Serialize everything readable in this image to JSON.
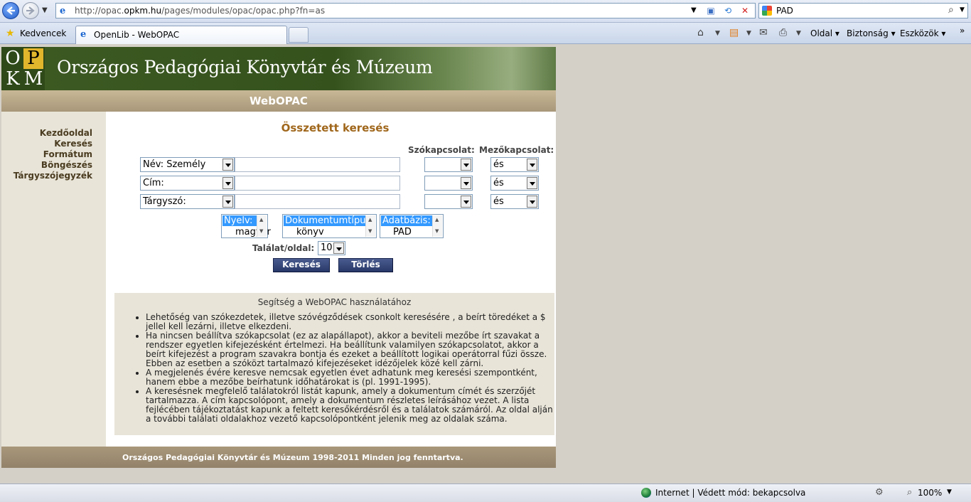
{
  "browser": {
    "url_prefix": "http://opac.",
    "url_host": "opkm.hu",
    "url_path": "/pages/modules/opac/opac.php?fn=as",
    "search_text": "PAD",
    "favorites_label": "Kedvencek",
    "tab_title": "OpenLib - WebOPAC",
    "menu": {
      "page": "Oldal",
      "security": "Biztonság",
      "tools": "Eszközök"
    },
    "status": {
      "zone": "Internet | Védett mód: bekapcsolva",
      "zoom": "100%"
    }
  },
  "site": {
    "logo_letters": [
      "O",
      "P",
      "K",
      "M"
    ],
    "title": "Országos Pedagógiai Könyvtár és Múzeum",
    "subtitle": "WebOPAC",
    "footer": "Országos Pedagógiai Könyvtár és Múzeum 1998-2011 Minden jog fenntartva."
  },
  "sidebar": {
    "items": [
      {
        "label": "Kezdőoldal"
      },
      {
        "label": "Keresés"
      },
      {
        "label": "Formátum"
      },
      {
        "label": "Böngészés"
      },
      {
        "label": "Tárgyszójegyzék"
      }
    ]
  },
  "form": {
    "title": "Összetett keresés",
    "word_relation_header": "Szókapcsolat:",
    "field_relation_header": "Mezőkapcsolat:",
    "rows": [
      {
        "field": "Név: Személy",
        "value": "",
        "word_relation": "",
        "field_relation": "és"
      },
      {
        "field": "Cím:",
        "value": "",
        "word_relation": "",
        "field_relation": "és"
      },
      {
        "field": "Tárgyszó:",
        "value": "",
        "word_relation": "",
        "field_relation": "és"
      }
    ],
    "filters": {
      "language": {
        "header": "Nyelv:",
        "value": "magyar"
      },
      "doctype": {
        "header": "Dokumentumtípus:",
        "value": "könyv"
      },
      "database": {
        "header": "Adatbázis:",
        "value": "PAD"
      }
    },
    "hits_label": "Találat/oldal:",
    "hits_value": "10",
    "search_button": "Keresés",
    "clear_button": "Törlés"
  },
  "help": {
    "title": "Segítség a WebOPAC használatához",
    "items": [
      "Lehetőség van szókezdetek, illetve szóvégződések csonkolt keresésére , a beírt töredéket a $ jellel kell lezárni, illetve elkezdeni.",
      "Ha nincsen beállítva szókapcsolat (ez az alapállapot), akkor a beviteli mezőbe írt szavakat a rendszer egyetlen kifejezésként értelmezi. Ha beállítunk valamilyen szókapcsolatot, akkor a beírt kifejezést a program szavakra bontja és ezeket a beállított logikai operátorral fűzi össze. Ebben az esetben a szóközt tartalmazó kifejezéseket idézőjelek közé kell zárni.",
      "A megjelenés évére keresve nemcsak egyetlen évet adhatunk meg keresési szempontként, hanem ebbe a mezőbe beírhatunk időhatárokat is (pl. 1991-1995).",
      "A keresésnek megfelelő találatokról listát kapunk, amely a dokumentum címét és szerzőjét tartalmazza. A cím kapcsolópont, amely a dokumentum részletes leírásához vezet. A lista fejlécében tájékoztatást kapunk a feltett keresőkérdésről és a találatok számáról. Az oldal alján a további találati oldalakhoz vezető kapcsolópontként jelenik meg az oldalak száma."
    ]
  },
  "colors": {
    "banner_green": "#3d5a23",
    "logo_yellow": "#e2b62c",
    "title_orange": "#a0671c",
    "button_blue": "#273868",
    "tan": "#a8977a"
  }
}
